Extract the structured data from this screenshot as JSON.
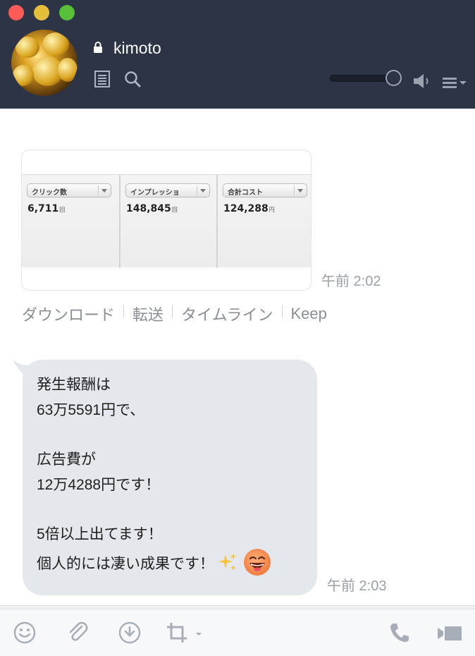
{
  "window": {
    "title": "kimoto"
  },
  "header": {
    "icons": [
      "lock-icon",
      "notes-icon",
      "search-icon",
      "speaker-icon",
      "menu-icon"
    ],
    "volume_level": 0.85,
    "background_color": "#2c3446"
  },
  "image_message": {
    "stats": [
      {
        "label": "クリック数",
        "value": "6,711",
        "unit": "回"
      },
      {
        "label": "インプレッショ",
        "value": "148,845",
        "unit": "回"
      },
      {
        "label": "合計コスト",
        "value": "124,288",
        "unit": "円"
      }
    ],
    "time": "午前 2:02",
    "actions": [
      "ダウンロード",
      "転送",
      "タイムライン",
      "Keep"
    ]
  },
  "text_message": {
    "lines": [
      "発生報酬は",
      "63万5591円で、",
      "",
      "広告費が",
      "12万4288円です！",
      "",
      "5倍以上出てます！",
      "個人的には凄い成果です！"
    ],
    "emoji": [
      "sparkles-emoji",
      "grinning-face-emoji"
    ],
    "time": "午前 2:03",
    "bubble_color": "#e4e7eb"
  },
  "footer": {
    "icons": [
      "emoji-icon",
      "attach-icon",
      "download-icon",
      "crop-icon",
      "call-icon",
      "video-icon"
    ]
  }
}
